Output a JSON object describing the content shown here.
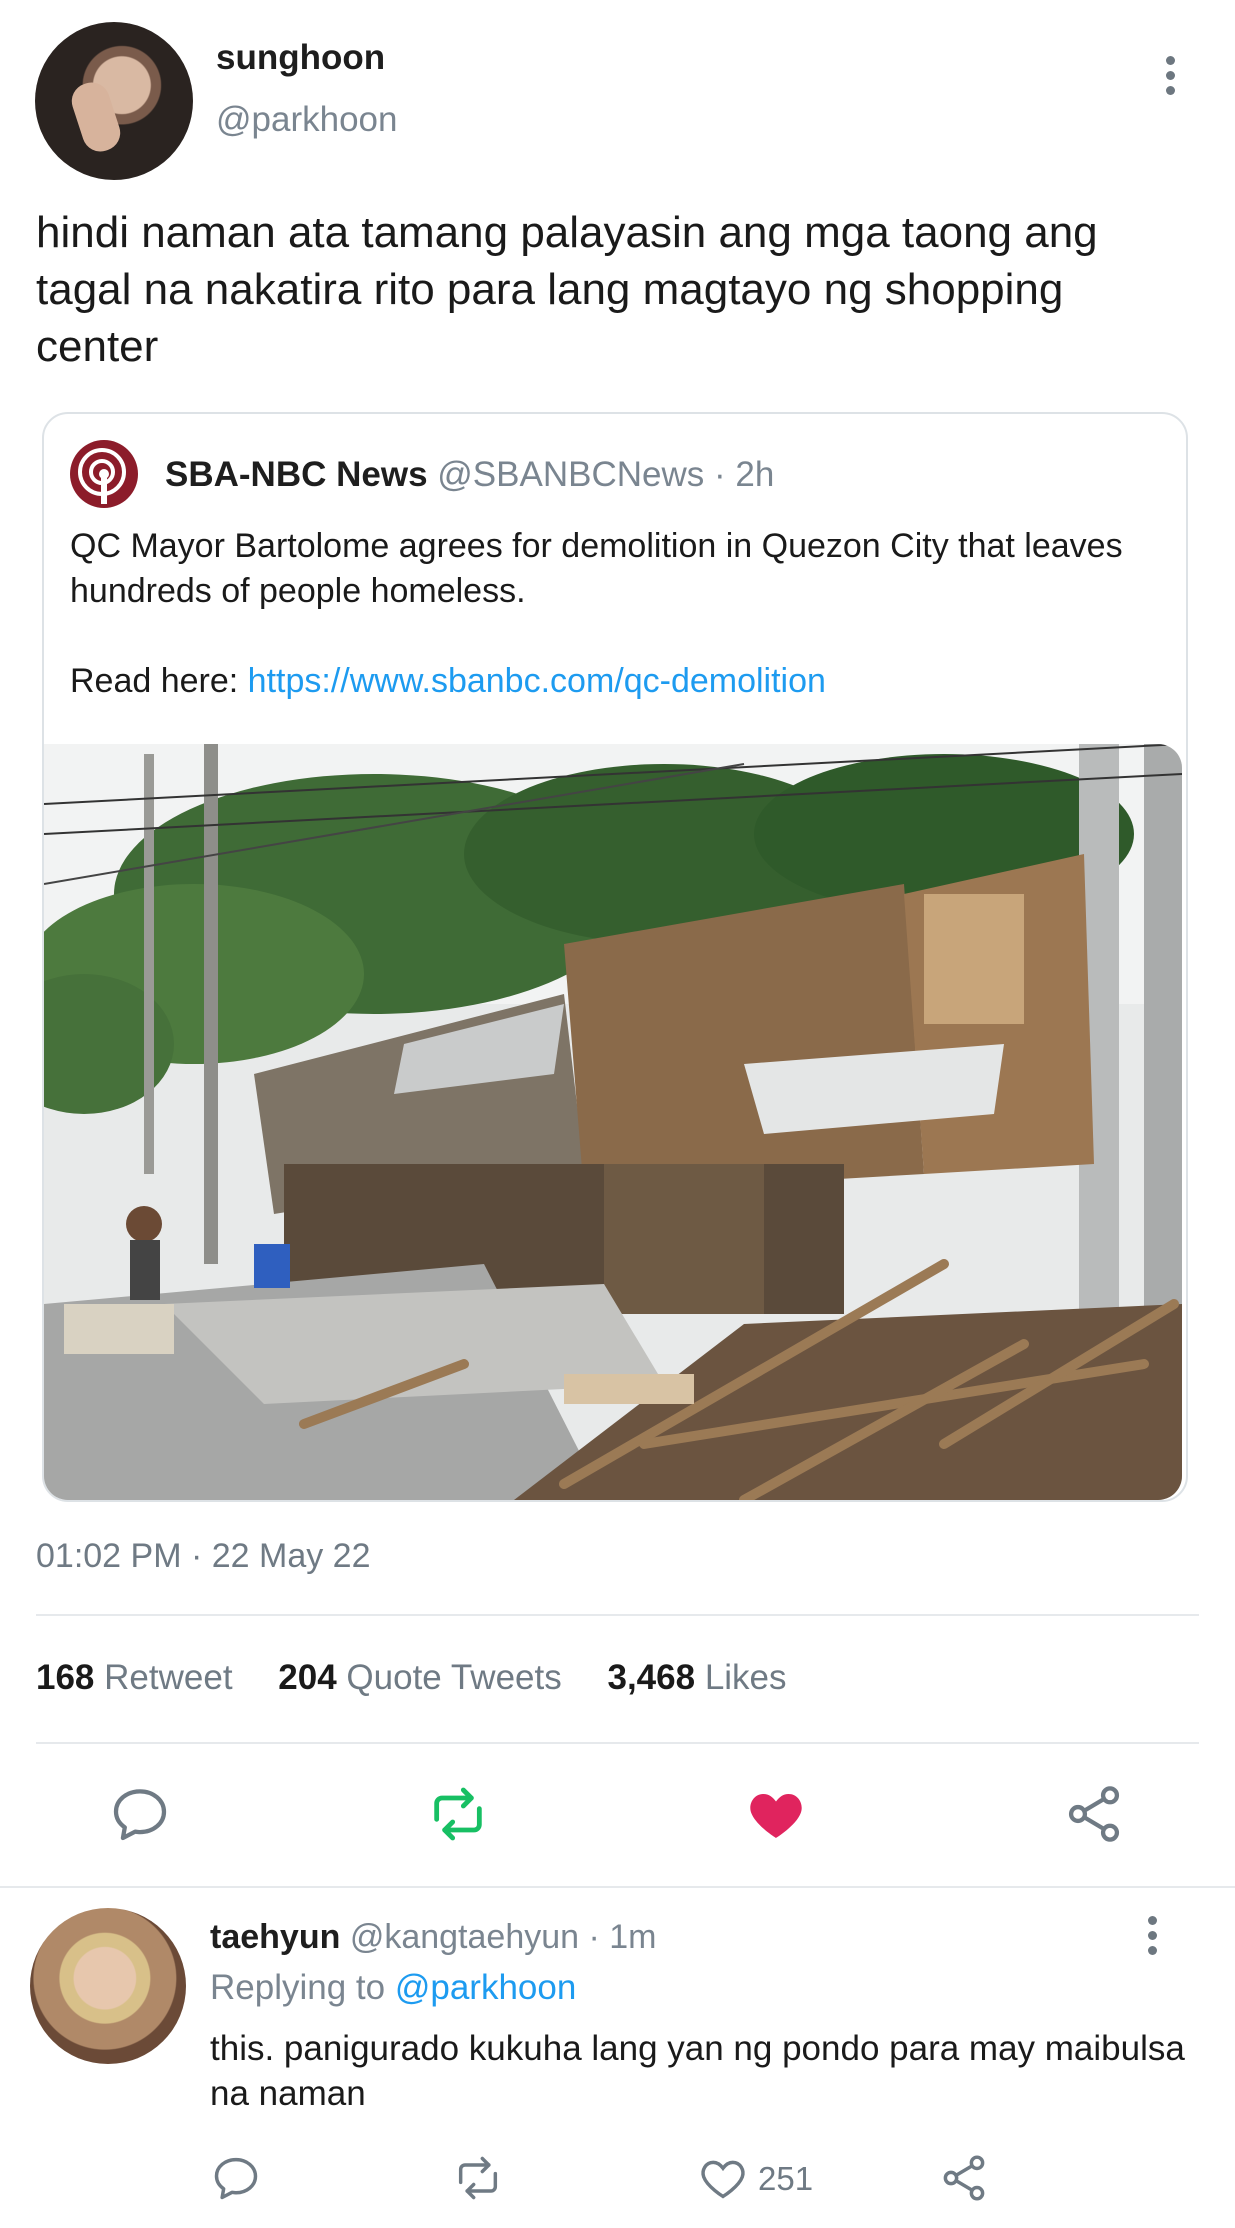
{
  "tweet": {
    "author": {
      "display_name": "sunghoon",
      "handle": "@parkhoon",
      "avatar_icon": "user-avatar"
    },
    "text": "hindi naman ata tamang palayasin ang mga taong ang tagal na nakatira rito para lang magtayo ng shopping center",
    "quoted": {
      "logo_icon": "news-logo",
      "name": "SBA-NBC News",
      "handle": "@SBANBCNews",
      "sep": " · ",
      "time": "2h",
      "text_line1": "QC Mayor Bartolome agrees for demolition in Quezon City that leaves hundreds of people homeless.",
      "read_label": "Read here: ",
      "link": "https://www.sbanbc.com/qc-demolition",
      "image_alt": "demolished-shanties-photo"
    },
    "timestamp": "01:02 PM · 22 May 22",
    "stats": {
      "retweets_count": "168",
      "retweets_label": "Retweet",
      "quotes_count": "204",
      "quotes_label": "Quote Tweets",
      "likes_count": "3,468",
      "likes_label": "Likes"
    },
    "actions": {
      "reply_icon": "reply-icon",
      "retweet_icon": "retweet-icon",
      "like_icon": "heart-icon",
      "share_icon": "share-icon",
      "retweet_active": true,
      "liked": true
    }
  },
  "reply": {
    "display_name": "taehyun",
    "handle": "@kangtaehyun",
    "sep": " · ",
    "time": "1m",
    "replying_label": "Replying to ",
    "replying_to": "@parkhoon",
    "text": "this. panigurado kukuha lang yan ng pondo para may maibulsa na naman",
    "like_count": "251"
  },
  "colors": {
    "link": "#1d9bf0",
    "retweet_green": "#17bf63",
    "like_red": "#e0245e",
    "muted": "#6f7a84"
  }
}
